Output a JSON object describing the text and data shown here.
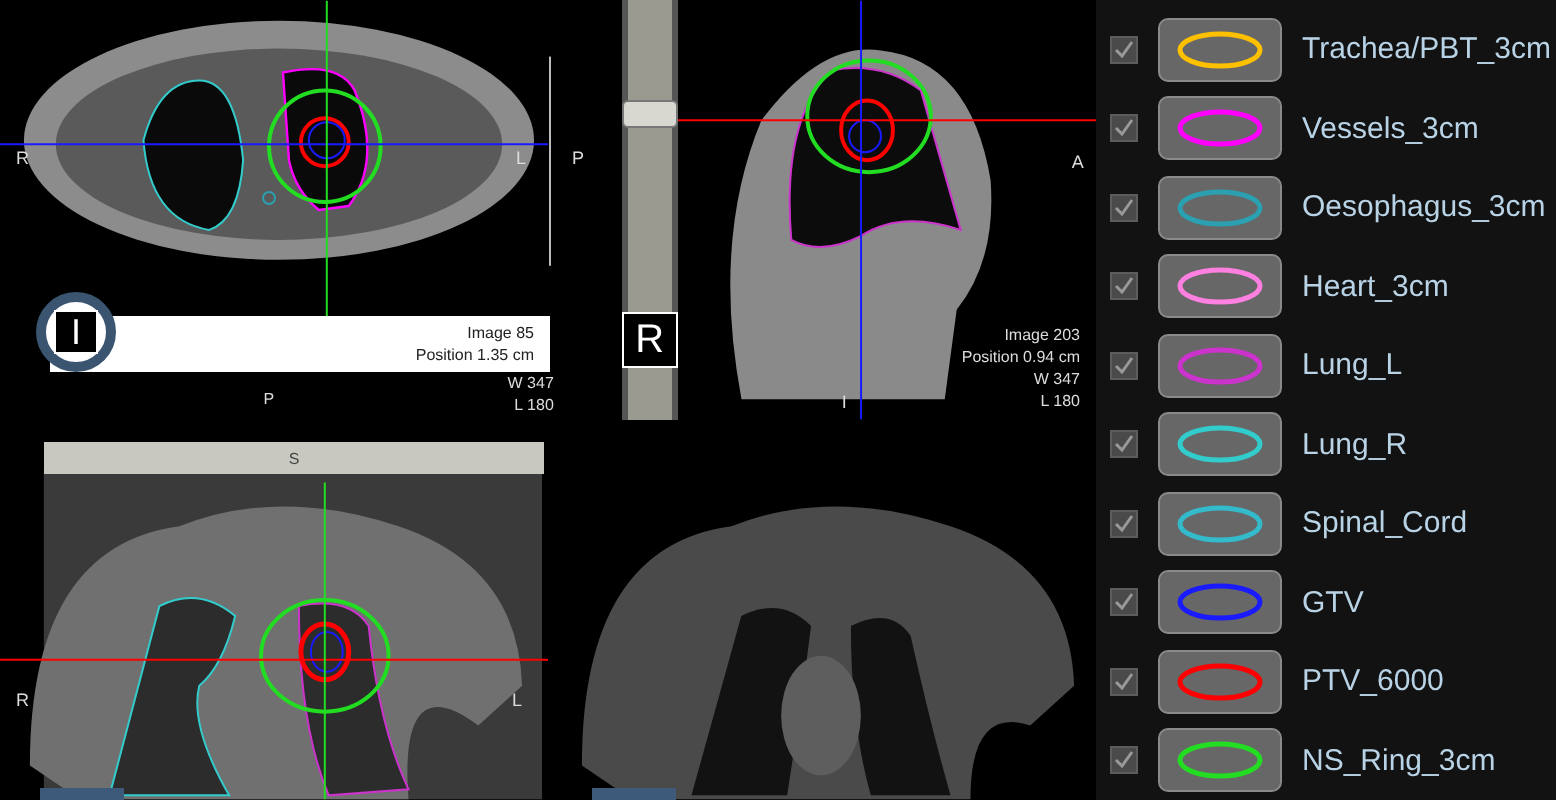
{
  "axial_view": {
    "orientation_button": "I",
    "left_label": "R",
    "right_label": "L",
    "side_label": "P",
    "bottom_label": "P",
    "info": [
      "Image 85",
      "Position 1.35 cm"
    ],
    "window": [
      "W 347",
      "L 180"
    ]
  },
  "sagittal_view": {
    "orientation_button": "R",
    "right_label": "A",
    "bottom_label": "I",
    "info": [
      "Image 203",
      "Position 0.94 cm",
      "W 347",
      "L 180"
    ],
    "slider": {
      "level": 0.72
    }
  },
  "coronal_view": {
    "top_label": "S",
    "left_label": "R",
    "right_label": "L"
  },
  "structures": [
    {
      "name": "Trachea/PBT_3cm",
      "color": "#ffc000",
      "checked": true
    },
    {
      "name": "Vessels_3cm",
      "color": "#ff00ff",
      "checked": true
    },
    {
      "name": "Oesophagus_3cm",
      "color": "#2aa0b0",
      "checked": true
    },
    {
      "name": "Heart_3cm",
      "color": "#ff80e0",
      "checked": true
    },
    {
      "name": "Lung_L",
      "color": "#cc33cc",
      "checked": true
    },
    {
      "name": "Lung_R",
      "color": "#33cccc",
      "checked": true
    },
    {
      "name": "Spinal_Cord",
      "color": "#33bbcc",
      "checked": true
    },
    {
      "name": "GTV",
      "color": "#1a1aff",
      "checked": true
    },
    {
      "name": "PTV_6000",
      "color": "#ff0000",
      "checked": true
    },
    {
      "name": "NS_Ring_3cm",
      "color": "#22dd22",
      "checked": true
    }
  ]
}
